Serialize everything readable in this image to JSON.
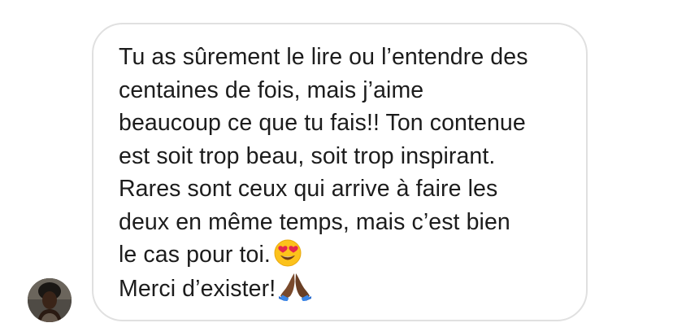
{
  "sender": {
    "avatar_icon": "user-avatar-icon"
  },
  "message": {
    "lines": [
      "Tu as sûrement le lire ou l’entendre des",
      "centaines de fois, mais j’aime",
      "beaucoup ce que tu fais!! Ton contenue",
      "est soit trop beau, soit trop inspirant.",
      "Rares sont ceux qui arrive à faire les",
      "deux en même temps, mais c’est bien",
      "le cas pour toi.",
      "Merci d’exister!"
    ],
    "emojis": {
      "line7": "heart-eyes-emoji-icon",
      "line8": "folded-hands-emoji-icon"
    }
  },
  "colors": {
    "bubble_border": "#e0e0e0",
    "text": "#1c1c1c",
    "background": "#ffffff"
  }
}
